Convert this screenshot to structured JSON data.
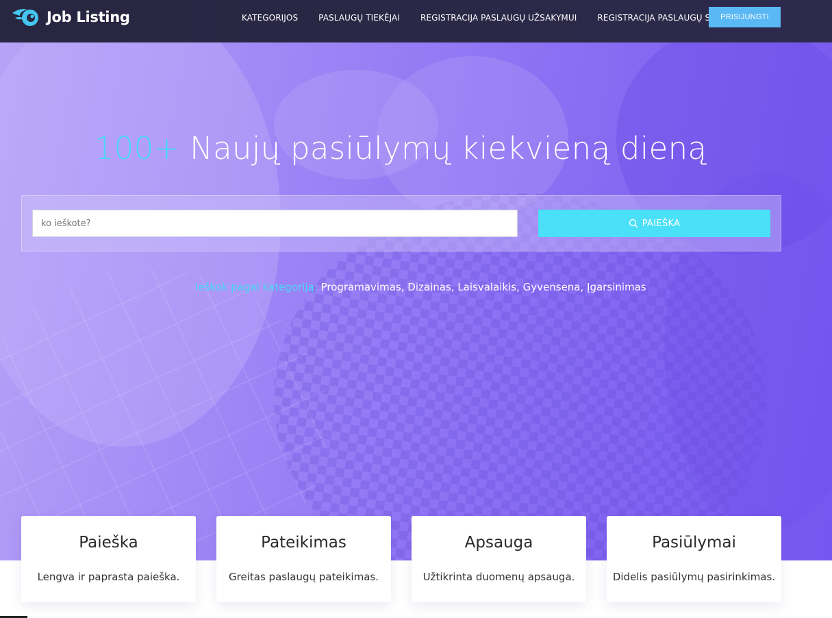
{
  "header": {
    "brand": "Job Listing",
    "nav": [
      "KATEGORIJOS",
      "PASLAUGŲ TIEKĖJAI",
      "REGISTRACIJA PASLAUGŲ UŽSAKYMUI",
      "REGISTRACIJA PASLAUGŲ SIŪLYMUI"
    ],
    "login": "PRISIJUNGTI"
  },
  "hero": {
    "title_accent": "100+",
    "title_rest": "Naujų pasiūlymų kiekvieną dieną",
    "search_placeholder": "ko ieškote?",
    "search_button": "PAIEŠKA",
    "category_label": "Ieškok pagal kategoriją:",
    "categories": [
      "Programavimas",
      "Dizainas",
      "Laisvalaikis",
      "Gyvensena",
      "Įgarsinimas"
    ]
  },
  "features": [
    {
      "title": "Paieška",
      "text": "Lengva ir paprasta paieška."
    },
    {
      "title": "Pateikimas",
      "text": "Greitas paslaugų pateikimas."
    },
    {
      "title": "Apsauga",
      "text": "Užtikrinta duomenų apsauga."
    },
    {
      "title": "Pasiūlymai",
      "text": "Didelis pasiūlymų pasirinkimas."
    }
  ],
  "colors": {
    "header_bg": "#2a2745",
    "accent_cyan": "#4ad9f6",
    "login_button": "#5ab8f5",
    "search_button": "#4ae0f7",
    "hero_gradient_start": "#b7a3f7",
    "hero_gradient_end": "#7556ef"
  },
  "icons": {
    "logo": "job-listing-logo",
    "search": "search-icon"
  }
}
